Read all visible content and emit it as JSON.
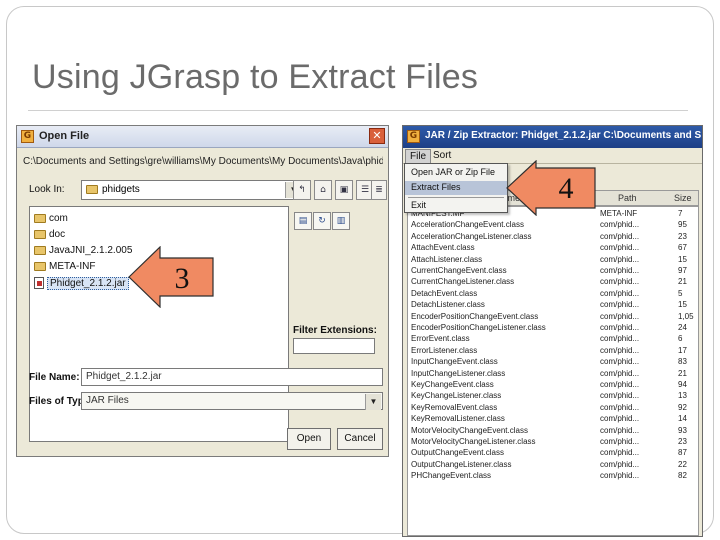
{
  "slide": {
    "title": "Using JGrasp to Extract Files"
  },
  "open_dialog": {
    "title": "Open File",
    "path": "C:\\Documents and Settings\\gre\\williams\\My Documents\\My Documents\\Java\\phidgets",
    "look_in_label": "Look In:",
    "look_in_value": "phidgets",
    "files": [
      {
        "name": "com",
        "type": "folder"
      },
      {
        "name": "doc",
        "type": "folder"
      },
      {
        "name": "JavaJNI_2.1.2.005",
        "type": "folder"
      },
      {
        "name": "META-INF",
        "type": "folder"
      },
      {
        "name": "Phidget_2.1.2.jar",
        "type": "jar",
        "selected": true
      }
    ],
    "filter_label": "Filter Extensions:",
    "file_name_label": "File Name:",
    "file_name_value": "Phidget_2.1.2.jar",
    "files_of_type_label": "Files of Type:",
    "files_of_type_value": "JAR Files",
    "open_button": "Open",
    "cancel_button": "Cancel"
  },
  "jar_window": {
    "title": "JAR / Zip Extractor:   Phidget_2.1.2.jar   C:\\Documents and S",
    "menus": [
      "File",
      "Sort"
    ],
    "file_menu": [
      "Open JAR or Zip File",
      "Extract Files",
      "Exit"
    ],
    "columns": [
      "Name",
      "Path",
      "Size"
    ],
    "rows": [
      {
        "name": "MANIFEST.MF",
        "path": "META-INF",
        "size": "7"
      },
      {
        "name": "AccelerationChangeEvent.class",
        "path": "com/phid...",
        "size": "95"
      },
      {
        "name": "AccelerationChangeListener.class",
        "path": "com/phid...",
        "size": "23"
      },
      {
        "name": "AttachEvent.class",
        "path": "com/phid...",
        "size": "67"
      },
      {
        "name": "AttachListener.class",
        "path": "com/phid...",
        "size": "15"
      },
      {
        "name": "CurrentChangeEvent.class",
        "path": "com/phid...",
        "size": "97"
      },
      {
        "name": "CurrentChangeListener.class",
        "path": "com/phid...",
        "size": "21"
      },
      {
        "name": "DetachEvent.class",
        "path": "com/phid...",
        "size": "5"
      },
      {
        "name": "DetachListener.class",
        "path": "com/phid...",
        "size": "15"
      },
      {
        "name": "EncoderPositionChangeEvent.class",
        "path": "com/phid...",
        "size": "1,05"
      },
      {
        "name": "EncoderPositionChangeListener.class",
        "path": "com/phid...",
        "size": "24"
      },
      {
        "name": "ErrorEvent.class",
        "path": "com/phid...",
        "size": "6"
      },
      {
        "name": "ErrorListener.class",
        "path": "com/phid...",
        "size": "17"
      },
      {
        "name": "InputChangeEvent.class",
        "path": "com/phid...",
        "size": "83"
      },
      {
        "name": "InputChangeListener.class",
        "path": "com/phid...",
        "size": "21"
      },
      {
        "name": "KeyChangeEvent.class",
        "path": "com/phid...",
        "size": "94"
      },
      {
        "name": "KeyChangeListener.class",
        "path": "com/phid...",
        "size": "13"
      },
      {
        "name": "KeyRemovalEvent.class",
        "path": "com/phid...",
        "size": "92"
      },
      {
        "name": "KeyRemovalListener.class",
        "path": "com/phid...",
        "size": "14"
      },
      {
        "name": "MotorVelocityChangeEvent.class",
        "path": "com/phid...",
        "size": "93"
      },
      {
        "name": "MotorVelocityChangeListener.class",
        "path": "com/phid...",
        "size": "23"
      },
      {
        "name": "OutputChangeEvent.class",
        "path": "com/phid...",
        "size": "87"
      },
      {
        "name": "OutputChangeListener.class",
        "path": "com/phid...",
        "size": "22"
      },
      {
        "name": "PHChangeEvent.class",
        "path": "com/phid...",
        "size": "82"
      }
    ]
  },
  "callouts": [
    {
      "label": "3"
    },
    {
      "label": "4"
    }
  ],
  "colors": {
    "callout_fill": "#f08a62",
    "callout_stroke": "#2e2e2e",
    "title_text": "#6b6b6b",
    "titlebar_blue": "#2e5aa8"
  }
}
